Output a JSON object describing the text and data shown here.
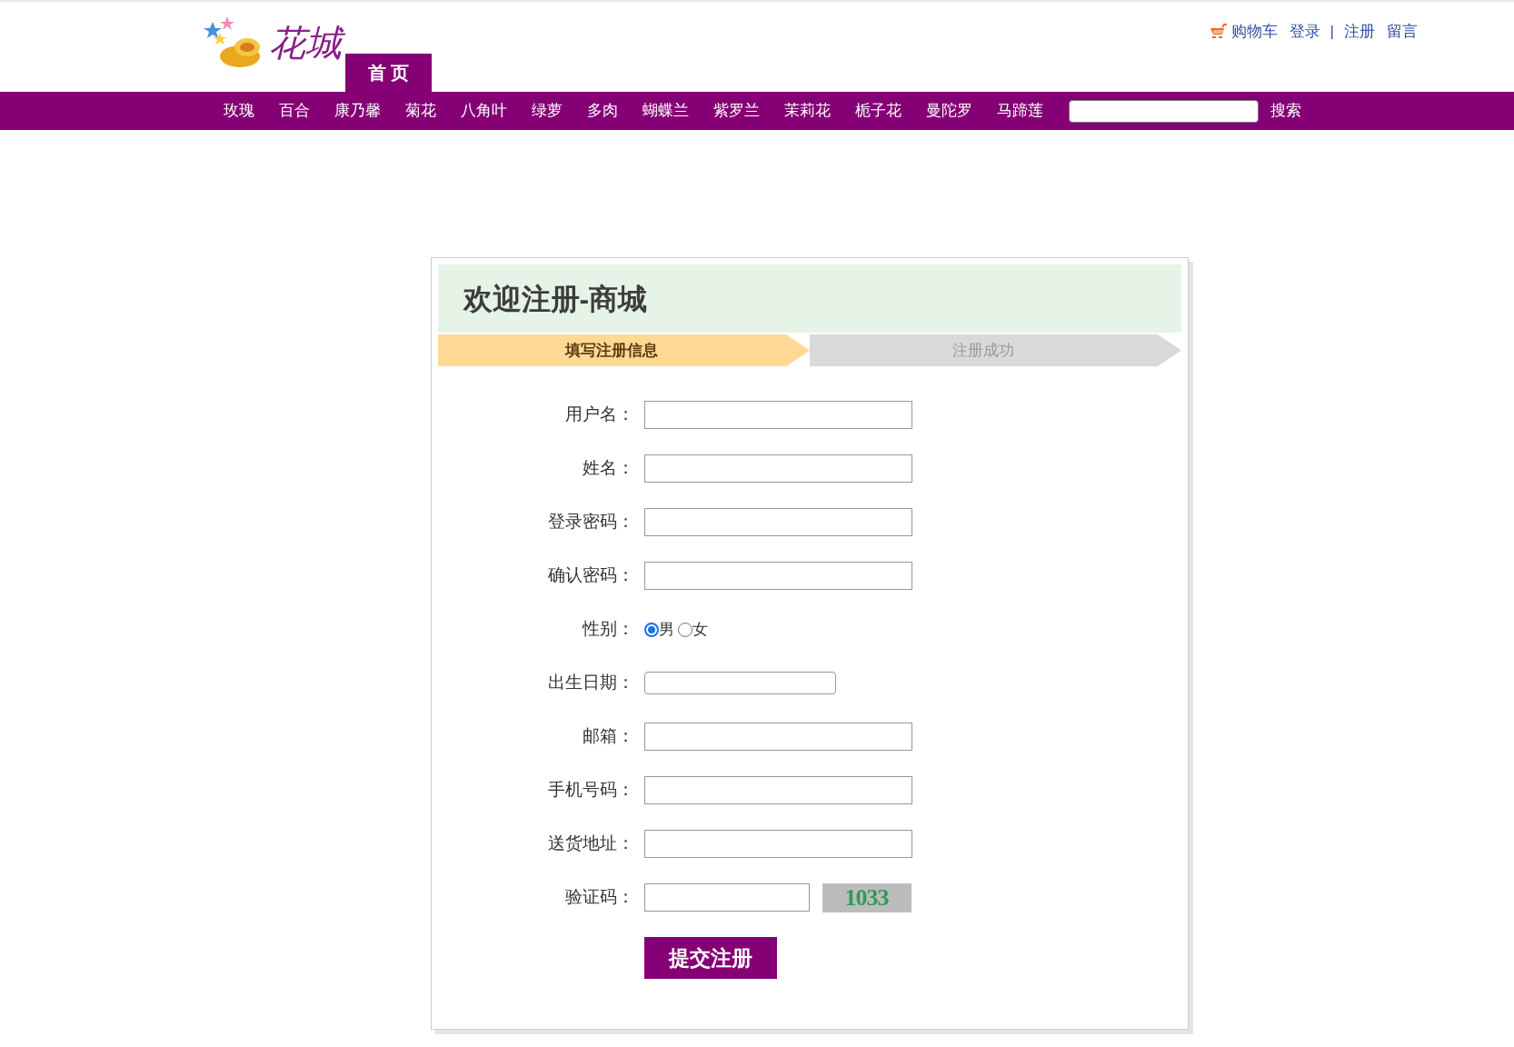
{
  "header": {
    "logo": "花城",
    "home_tab": "首 页",
    "top_links": [
      {
        "kind": "cart",
        "label": "购物车"
      },
      {
        "kind": "link",
        "label": "登录"
      },
      {
        "kind": "separator",
        "label": "|"
      },
      {
        "kind": "link",
        "label": "注册"
      },
      {
        "kind": "link",
        "label": "留言"
      }
    ]
  },
  "nav": {
    "items": [
      "玫瑰",
      "百合",
      "康乃馨",
      "菊花",
      "八角叶",
      "绿萝",
      "多肉",
      "蝴蝶兰",
      "紫罗兰",
      "茉莉花",
      "栀子花",
      "曼陀罗",
      "马蹄莲"
    ],
    "search_button": "搜索"
  },
  "form": {
    "title": "欢迎注册-商城",
    "steps": [
      {
        "label": "填写注册信息",
        "selected": true
      },
      {
        "label": "注册成功",
        "selected": false
      }
    ],
    "fields": [
      {
        "kind": "text",
        "label": "用户名："
      },
      {
        "kind": "text",
        "label": "姓名："
      },
      {
        "kind": "text",
        "label": "登录密码："
      },
      {
        "kind": "text",
        "label": "确认密码："
      },
      {
        "kind": "radio",
        "label": "性别：",
        "options": [
          {
            "label": "男",
            "selected": true
          },
          {
            "label": "女",
            "selected": false
          }
        ]
      },
      {
        "kind": "date",
        "label": "出生日期："
      },
      {
        "kind": "text",
        "label": "邮箱："
      },
      {
        "kind": "text",
        "label": "手机号码："
      },
      {
        "kind": "text",
        "label": "送货地址："
      },
      {
        "kind": "captcha",
        "label": "验证码：",
        "captcha": "1033"
      }
    ],
    "submit": "提交注册"
  }
}
